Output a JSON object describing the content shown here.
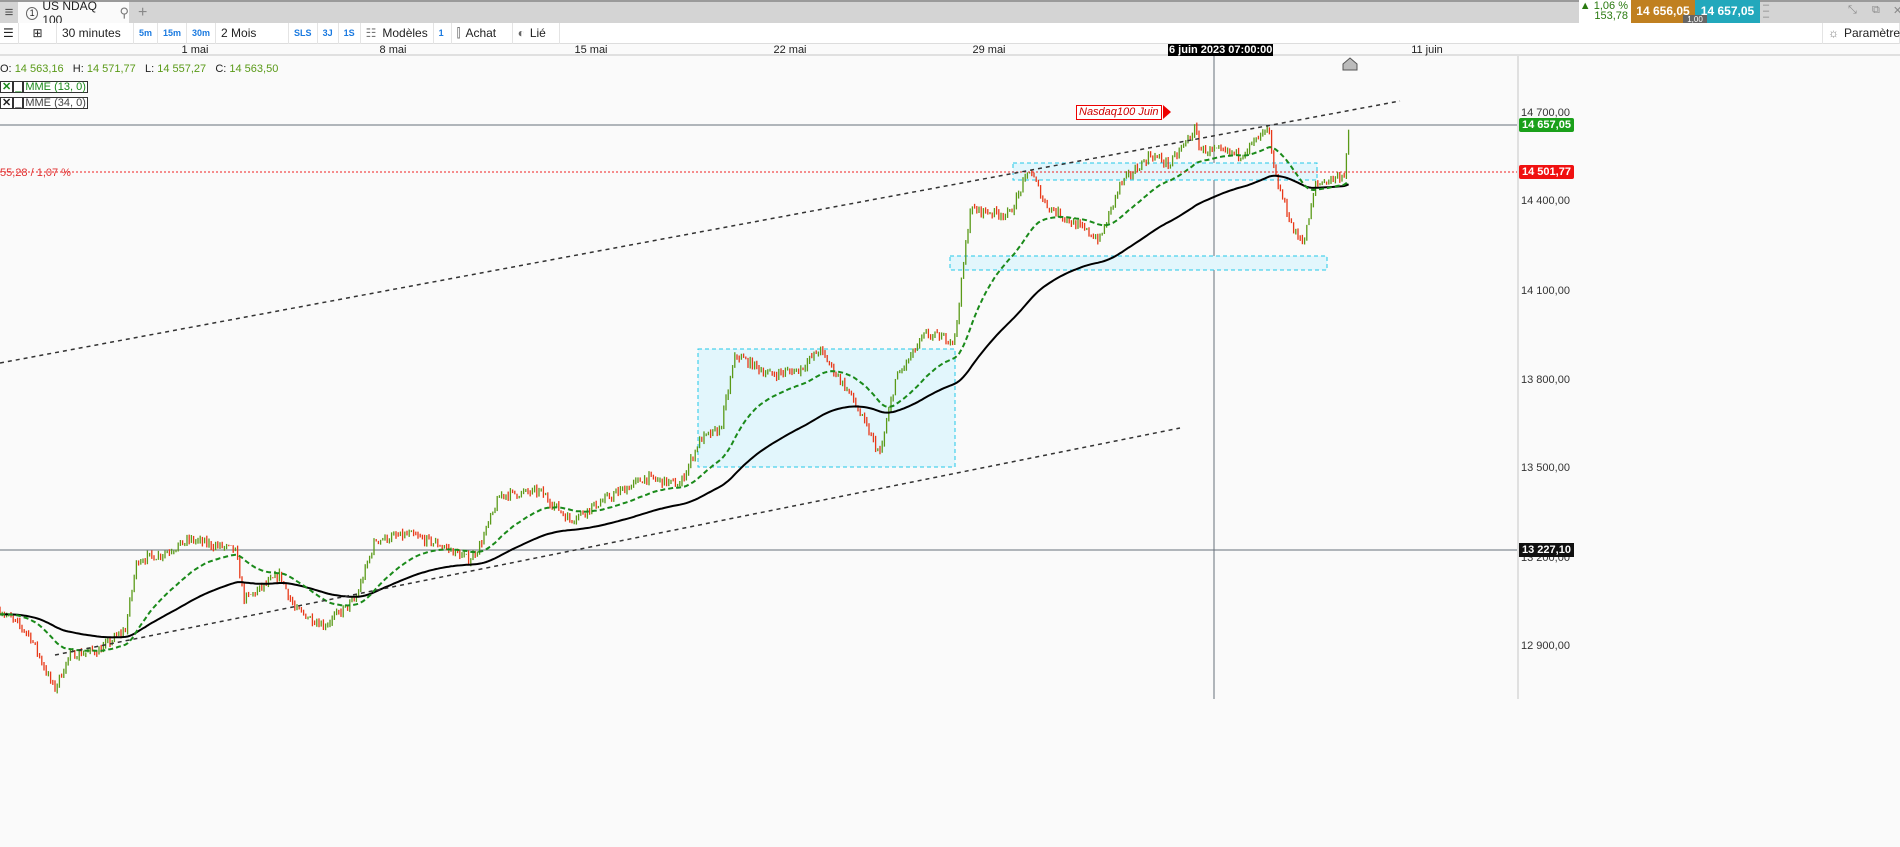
{
  "tabbar": {
    "menu_icon": "hamburger-icon",
    "tab_number": "1",
    "tab_title": "US NDAQ 100",
    "search_icon": "search-icon",
    "add_icon": "plus-icon"
  },
  "quote": {
    "change_pct": "▲ 1,06 %",
    "change_abs": "153,78",
    "bid": "14 656,05",
    "ask": "14 657,05",
    "spread": "1,00",
    "bid_color": "#c08020",
    "ask_color": "#22a8bc"
  },
  "toolbar": {
    "interval": "30 minutes",
    "quick_intervals": [
      "5m",
      "15m",
      "30m"
    ],
    "period": "2 Mois",
    "quick_periods": [
      "SLS",
      "3J",
      "1S"
    ],
    "templates": "Modèles",
    "one": "1",
    "order": "Achat",
    "linked": "Lié",
    "settings": "Paramètres"
  },
  "ohlc": {
    "o_label": "O:",
    "o": "14 563,16",
    "h_label": "H:",
    "h": "14 571,77",
    "l_label": "L:",
    "l": "14 557,27",
    "c_label": "C:",
    "c": "14 563,50"
  },
  "indicators": [
    {
      "label": "MME (13, 0)",
      "color": "#1a8a1a"
    },
    {
      "label": "MME (34, 0)",
      "color": "#000000"
    }
  ],
  "annotation": "Nasdaq100 Juin",
  "ref_line_label": "55,28 / 1,07 %",
  "chart_data": {
    "type": "candlestick",
    "x_ticks": [
      "1 mai",
      "8 mai",
      "15 mai",
      "22 mai",
      "29 mai",
      "11 juin"
    ],
    "crosshair_label": "6 juin 2023 07:00:00",
    "y_ticks": [
      "14 700,00",
      "14 400,00",
      "14 100,00",
      "13 800,00",
      "13 500,00",
      "13 200,00",
      "12 900,00"
    ],
    "ylim": [
      12725,
      14890
    ],
    "price_tags": {
      "last": "14 657,05",
      "reference": "14 501,77",
      "crosshair": "13 227,10"
    },
    "colors": {
      "up": "#5a9a18",
      "down": "#e83818",
      "ema13": "#1a8a1a",
      "ema34": "#000000",
      "zone": "#22c8e8"
    },
    "price_path": [
      [
        "2023-04-24T03:00",
        13025
      ],
      [
        "2023-04-25T04:00",
        12941
      ],
      [
        "2023-04-26T01:00",
        12756
      ],
      [
        "2023-04-26T14:00",
        12873
      ],
      [
        "2023-04-27T15:00",
        12890
      ],
      [
        "2023-04-28T13:00",
        12958
      ],
      [
        "2023-04-28T23:00",
        13194
      ],
      [
        "2023-04-29T18:00",
        13210
      ],
      [
        "2023-04-30T20:00",
        13261
      ],
      [
        "2023-05-02T10:00",
        13227
      ],
      [
        "2023-05-02T18:00",
        13059
      ],
      [
        "2023-05-04T00:00",
        13143
      ],
      [
        "2023-05-04T13:00",
        13025
      ],
      [
        "2023-05-05T14:00",
        12974
      ],
      [
        "2023-05-06T16:00",
        13059
      ],
      [
        "2023-05-07T09:00",
        13261
      ],
      [
        "2023-05-08T14:00",
        13278
      ],
      [
        "2023-05-09T16:00",
        13244
      ],
      [
        "2023-05-10T17:00",
        13194
      ],
      [
        "2023-05-11T02:00",
        13244
      ],
      [
        "2023-05-11T19:00",
        13413
      ],
      [
        "2023-05-13T05:00",
        13423
      ],
      [
        "2023-05-14T06:00",
        13328
      ],
      [
        "2023-05-15T16:00",
        13406
      ],
      [
        "2023-05-16T22:00",
        13470
      ],
      [
        "2023-05-18T03:00",
        13446
      ],
      [
        "2023-05-18T20:00",
        13598
      ],
      [
        "2023-05-19T13:00",
        13632
      ],
      [
        "2023-05-20T02:00",
        13884
      ],
      [
        "2023-05-21T07:00",
        13817
      ],
      [
        "2023-05-22T08:00",
        13834
      ],
      [
        "2023-05-23T01:00",
        13901
      ],
      [
        "2023-05-24T03:00",
        13750
      ],
      [
        "2023-05-25T04:00",
        13547
      ],
      [
        "2023-05-25T17:00",
        13800
      ],
      [
        "2023-05-26T18:00",
        13952
      ],
      [
        "2023-05-27T19:00",
        13935
      ],
      [
        "2023-05-28T08:00",
        14373
      ],
      [
        "2023-05-29T18:00",
        14356
      ],
      [
        "2023-05-30T12:00",
        14508
      ],
      [
        "2023-05-31T02:00",
        14390
      ],
      [
        "2023-06-01T04:00",
        14323
      ],
      [
        "2023-06-02T02:00",
        14272
      ],
      [
        "2023-06-02T20:00",
        14457
      ],
      [
        "2023-06-03T23:00",
        14558
      ],
      [
        "2023-06-04T16:00",
        14524
      ],
      [
        "2023-06-05T14:00",
        14643
      ],
      [
        "2023-06-05T19:00",
        14575
      ],
      [
        "2023-06-06T21:00",
        14558
      ],
      [
        "2023-06-07T12:00",
        14643
      ],
      [
        "2023-06-07T15:00",
        14491
      ],
      [
        "2023-06-08T02:00",
        14289
      ],
      [
        "2023-06-08T07:00",
        14272
      ],
      [
        "2023-06-08T13:00",
        14457
      ],
      [
        "2023-06-09T04:00",
        14491
      ],
      [
        "2023-06-09T07:00",
        14657
      ]
    ]
  }
}
